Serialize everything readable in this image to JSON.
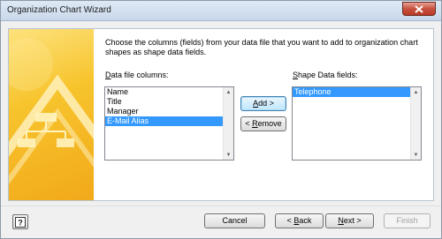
{
  "window": {
    "title": "Organization Chart Wizard"
  },
  "instructions": "Choose the columns (fields) from your data file that you want to add to organization chart shapes as shape data fields.",
  "data_file_columns": {
    "label_accel": "D",
    "label_rest": "ata file columns:",
    "items": [
      "Name",
      "Title",
      "Manager",
      "E-Mail Alias"
    ],
    "selected_index": 3
  },
  "shape_data_fields": {
    "label_accel": "S",
    "label_rest": "hape Data fields:",
    "items": [
      "Telephone"
    ],
    "selected_index": 0
  },
  "buttons": {
    "add_accel": "A",
    "add_rest": "dd >",
    "remove_prefix": "< ",
    "remove_accel": "R",
    "remove_rest": "emove",
    "cancel": "Cancel",
    "back_prefix": "< ",
    "back_accel": "B",
    "back_rest": "ack",
    "next_accel": "N",
    "next_rest": "ext >",
    "finish": "Finish"
  },
  "icons": {
    "close": "close-icon",
    "help": "help-icon",
    "banner": "org-chart-illustration"
  },
  "colors": {
    "selection": "#3399ff",
    "banner": "#f7c42d",
    "close_button": "#c7513f"
  }
}
